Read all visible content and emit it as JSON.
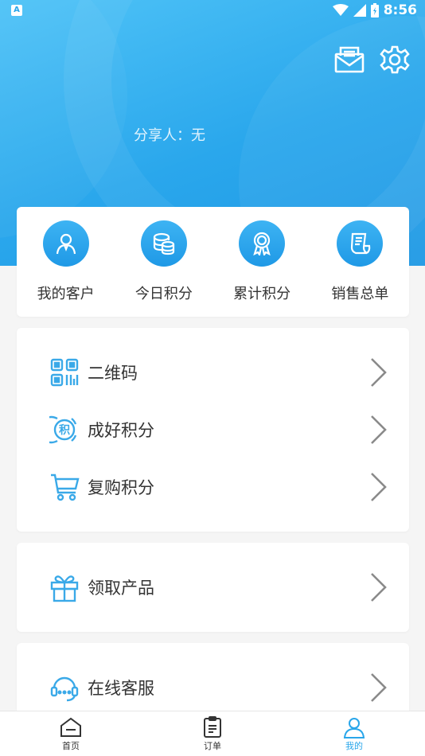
{
  "status_bar": {
    "notification_badge": "A",
    "time": "8:56"
  },
  "profile": {
    "sharer_label": "分享人：无"
  },
  "quick_actions": [
    {
      "label": "我的客户",
      "icon": "person-icon"
    },
    {
      "label": "今日积分",
      "icon": "coins-icon"
    },
    {
      "label": "累计积分",
      "icon": "award-icon"
    },
    {
      "label": "销售总单",
      "icon": "receipt-icon"
    }
  ],
  "menu_group_1": [
    {
      "label": "二维码",
      "icon": "qr-code-icon"
    },
    {
      "label": "成好积分",
      "icon": "points-icon"
    },
    {
      "label": "复购积分",
      "icon": "cart-icon"
    }
  ],
  "menu_group_2": [
    {
      "label": "领取产品",
      "icon": "gift-icon"
    }
  ],
  "menu_group_3": [
    {
      "label": "在线客服",
      "icon": "headset-icon"
    }
  ],
  "tab_bar": {
    "tabs": [
      {
        "label": "首页",
        "icon": "home-icon"
      },
      {
        "label": "订单",
        "icon": "clipboard-icon"
      },
      {
        "label": "我的",
        "icon": "user-icon"
      }
    ],
    "active_color": "#29a6ea"
  },
  "colors": {
    "accent": "#29a6ea",
    "icon_blue": "#3aa9e8"
  }
}
